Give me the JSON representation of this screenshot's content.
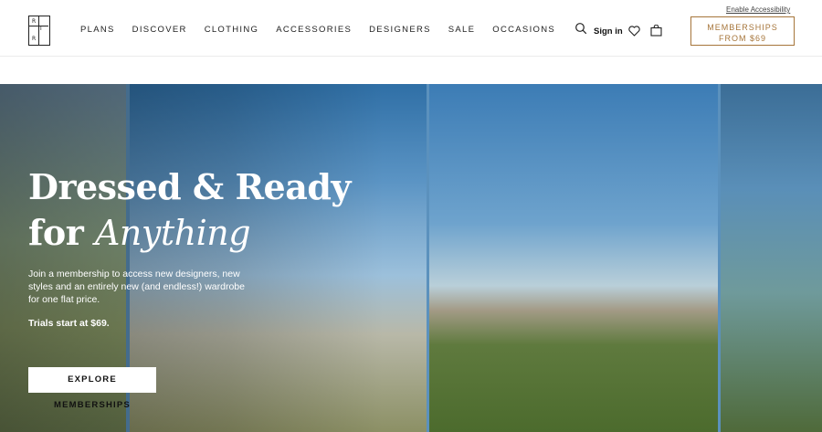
{
  "header": {
    "logo_letters": [
      "R",
      "T",
      "R"
    ],
    "nav": [
      "PLANS",
      "DISCOVER",
      "CLOTHING",
      "ACCESSORIES",
      "DESIGNERS",
      "SALE",
      "OCCASIONS"
    ],
    "search_icon": "search-icon",
    "signin": "Sign in",
    "heart_icon": "heart-icon",
    "bag_icon": "shopping-bag-icon",
    "accessibility": "Enable Accessibility",
    "memberships_line1": "MEMBERSHIPS",
    "memberships_line2": "FROM $69",
    "accent_color": "#a6753a"
  },
  "hero": {
    "title_line1": "Dressed & Ready",
    "title_line2_prefix": "for ",
    "title_line2_italic": "Anything",
    "copy": "Join a membership to access new designers, new styles and an entirely new (and endless!) wardrobe for one flat price.",
    "trial": "Trials start at $69.",
    "button": "EXPLORE MEMBERSHIPS"
  }
}
